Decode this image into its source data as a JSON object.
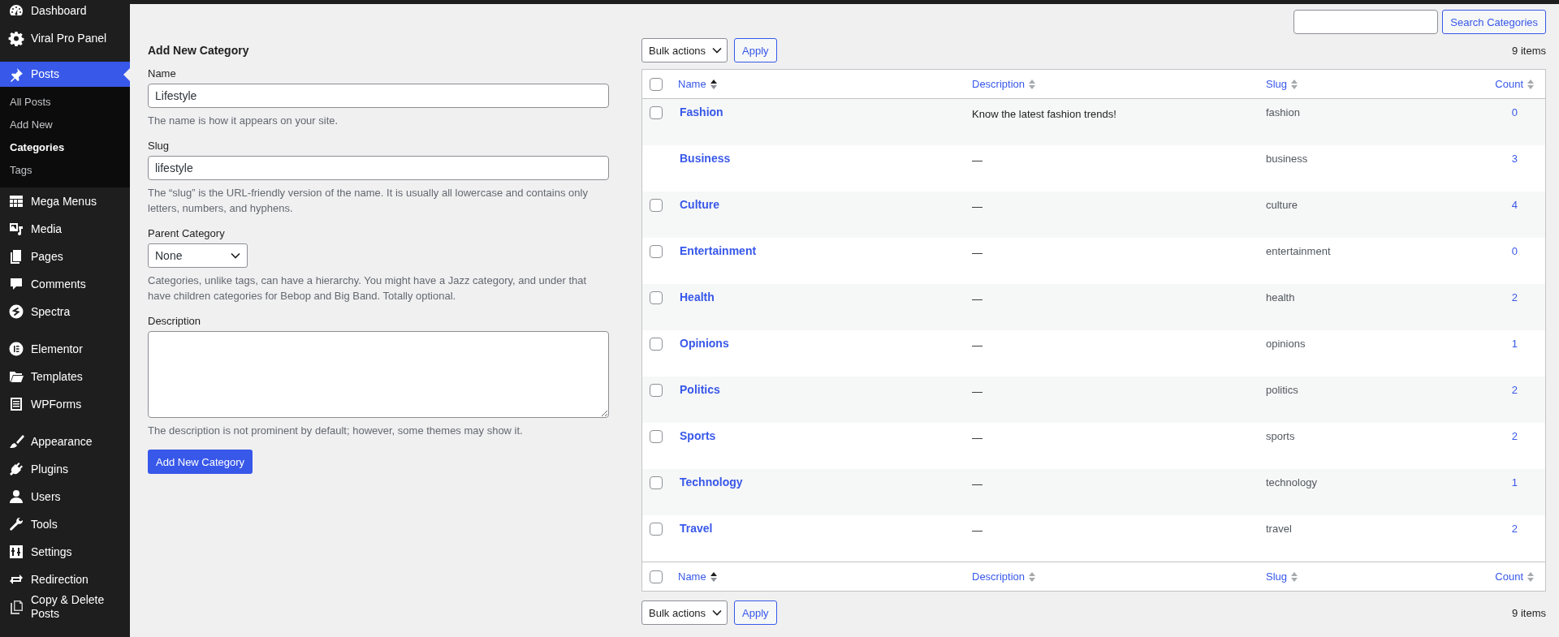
{
  "sidebar": {
    "groups": [
      {
        "items": [
          {
            "label": "Dashboard",
            "selected": false
          },
          {
            "label": "Viral Pro Panel",
            "selected": false
          }
        ]
      },
      {
        "items": [
          {
            "label": "Posts",
            "selected": true,
            "submenu": [
              {
                "label": "All Posts",
                "selected": false
              },
              {
                "label": "Add New",
                "selected": false
              },
              {
                "label": "Categories",
                "selected": true
              },
              {
                "label": "Tags",
                "selected": false
              }
            ]
          },
          {
            "label": "Mega Menus",
            "selected": false
          },
          {
            "label": "Media",
            "selected": false
          },
          {
            "label": "Pages",
            "selected": false
          },
          {
            "label": "Comments",
            "selected": false
          },
          {
            "label": "Spectra",
            "selected": false
          }
        ]
      },
      {
        "items": [
          {
            "label": "Elementor",
            "selected": false
          },
          {
            "label": "Templates",
            "selected": false
          },
          {
            "label": "WPForms",
            "selected": false
          }
        ]
      },
      {
        "items": [
          {
            "label": "Appearance",
            "selected": false
          },
          {
            "label": "Plugins",
            "selected": false
          },
          {
            "label": "Users",
            "selected": false
          },
          {
            "label": "Tools",
            "selected": false
          },
          {
            "label": "Settings",
            "selected": false
          },
          {
            "label": "Redirection",
            "selected": false
          },
          {
            "label": "Copy & Delete Posts",
            "selected": false
          }
        ]
      }
    ]
  },
  "search": {
    "button": "Search Categories"
  },
  "form": {
    "title": "Add New Category",
    "fields": [
      {
        "kind": "text",
        "label": "Name",
        "value": "Lifestyle",
        "help": "The name is how it appears on your site."
      },
      {
        "kind": "text",
        "label": "Slug",
        "value": "lifestyle",
        "help": "The “slug” is the URL-friendly version of the name. It is usually all lowercase and contains only letters, numbers, and hyphens."
      },
      {
        "kind": "select",
        "label": "Parent Category",
        "value": "None",
        "help": "Categories, unlike tags, can have a hierarchy. You might have a Jazz category, and under that have children categories for Bebop and Big Band. Totally optional."
      },
      {
        "kind": "textarea",
        "label": "Description",
        "help": "The description is not prominent by default; however, some themes may show it."
      }
    ],
    "submit": "Add New Category"
  },
  "table": {
    "top_nav": {
      "bulk_action": "Bulk actions",
      "apply": "Apply",
      "count": "9 items"
    },
    "select_all_checked": false,
    "columns": [
      {
        "label": "Name",
        "sorted": true
      },
      {
        "label": "Description",
        "sorted": false
      },
      {
        "label": "Slug",
        "sorted": false
      },
      {
        "label": "Count",
        "sorted": false
      }
    ],
    "rows": [
      {
        "name": "Fashion",
        "description": "Know the latest fashion trends!",
        "slug": "fashion",
        "count": "0",
        "selectable": true,
        "checked": false
      },
      {
        "name": "Business",
        "description": "—",
        "slug": "business",
        "count": "3",
        "selectable": false
      },
      {
        "name": "Culture",
        "description": "—",
        "slug": "culture",
        "count": "4",
        "selectable": true,
        "checked": false
      },
      {
        "name": "Entertainment",
        "description": "—",
        "slug": "entertainment",
        "count": "0",
        "selectable": true,
        "checked": false
      },
      {
        "name": "Health",
        "description": "—",
        "slug": "health",
        "count": "2",
        "selectable": true,
        "checked": false
      },
      {
        "name": "Opinions",
        "description": "—",
        "slug": "opinions",
        "count": "1",
        "selectable": true,
        "checked": false
      },
      {
        "name": "Politics",
        "description": "—",
        "slug": "politics",
        "count": "2",
        "selectable": true,
        "checked": false
      },
      {
        "name": "Sports",
        "description": "—",
        "slug": "sports",
        "count": "2",
        "selectable": true,
        "checked": false
      },
      {
        "name": "Technology",
        "description": "—",
        "slug": "technology",
        "count": "1",
        "selectable": true,
        "checked": false
      },
      {
        "name": "Travel",
        "description": "—",
        "slug": "travel",
        "count": "2",
        "selectable": true,
        "checked": false
      }
    ],
    "footer_select_all_checked": false,
    "footer_columns": [
      {
        "label": "Name",
        "sorted": true
      },
      {
        "label": "Description",
        "sorted": false
      },
      {
        "label": "Slug",
        "sorted": false
      },
      {
        "label": "Count",
        "sorted": false
      }
    ],
    "bottom_nav": {
      "bulk_action": "Bulk actions",
      "apply": "Apply",
      "count": "9 items"
    }
  }
}
